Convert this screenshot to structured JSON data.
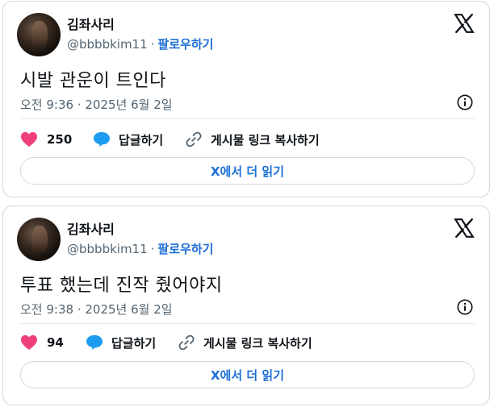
{
  "colors": {
    "like": "#f0407a",
    "reply": "#1d9bf0",
    "follow": "#1d6fd6",
    "muted": "#536471",
    "border": "#cfd9de"
  },
  "icons": [
    "x-logo-icon",
    "info-icon",
    "heart-icon",
    "reply-bubble-icon",
    "link-icon"
  ],
  "tweets": [
    {
      "name": "김좌사리",
      "handle": "@bbbbkim11",
      "separator": "·",
      "follow_label": "팔로우하기",
      "text": "시발 관운이 트인다",
      "timestamp": "오전 9:36 · 2025년 6월 2일",
      "likes": "250",
      "reply_label": "답글하기",
      "copy_link_label": "게시물 링크 복사하기",
      "read_more_label": "X에서 더 읽기"
    },
    {
      "name": "김좌사리",
      "handle": "@bbbbkim11",
      "separator": "·",
      "follow_label": "팔로우하기",
      "text": "투표 했는데 진작 줬어야지",
      "timestamp": "오전 9:38 · 2025년 6월 2일",
      "likes": "94",
      "reply_label": "답글하기",
      "copy_link_label": "게시물 링크 복사하기",
      "read_more_label": "X에서 더 읽기"
    }
  ]
}
